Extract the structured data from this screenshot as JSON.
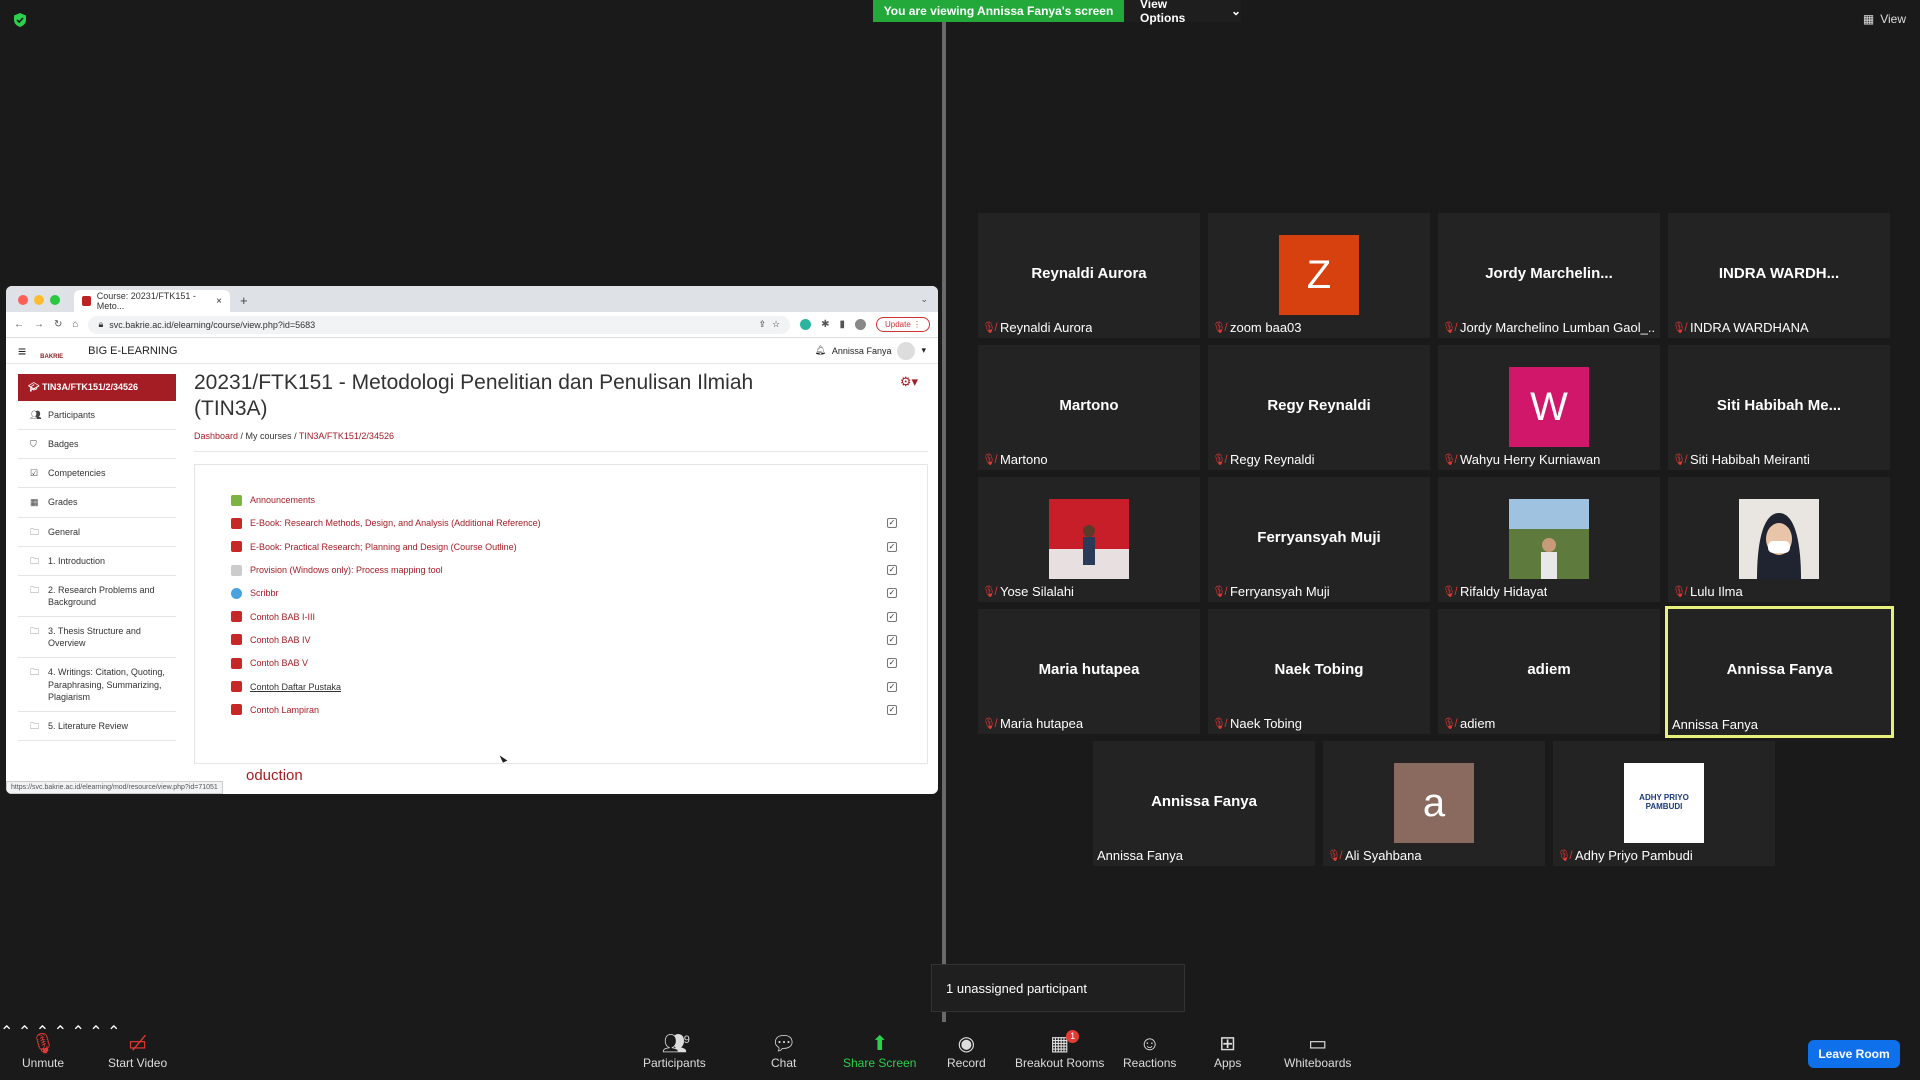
{
  "top": {
    "viewing_banner": "You are viewing Annissa Fanya's screen",
    "view_options": "View Options",
    "view": "View"
  },
  "browser": {
    "tab_title": "Course: 20231/FTK151 - Meto...",
    "url": "svc.bakrie.ac.id/elearning/course/view.php?id=5683",
    "update_label": "Update",
    "status_url": "https://svc.bakrie.ac.id/elearning/mod/resource/view.php?id=71051"
  },
  "site": {
    "brand": "BIG E-LEARNING",
    "logo_text": "BAKRIE",
    "user": "Annissa Fanya",
    "course_title": "20231/FTK151 - Metodologi Penelitian dan Penulisan Ilmiah (TIN3A)",
    "breadcrumb": [
      "Dashboard",
      "My courses",
      "TIN3A/FTK151/2/34526"
    ],
    "section_peek": "oduction"
  },
  "leftnav": {
    "header": "TIN3A/FTK151/2/34526",
    "items": [
      {
        "icon": "users-icon",
        "label": "Participants"
      },
      {
        "icon": "badge-icon",
        "label": "Badges"
      },
      {
        "icon": "checkbox-icon",
        "label": "Competencies"
      },
      {
        "icon": "table-icon",
        "label": "Grades"
      },
      {
        "icon": "folder-icon",
        "label": "General"
      },
      {
        "icon": "folder-icon",
        "label": "1. Introduction"
      },
      {
        "icon": "folder-icon",
        "label": "2. Research Problems and Background"
      },
      {
        "icon": "folder-icon",
        "label": "3. Thesis Structure and Overview"
      },
      {
        "icon": "folder-icon",
        "label": "4. Writings: Citation, Quoting, Paraphrasing, Summarizing, Plagiarism"
      },
      {
        "icon": "folder-icon",
        "label": "5. Literature Review"
      }
    ]
  },
  "resources": [
    {
      "label": "Announcements",
      "icon": "forum-icon"
    },
    {
      "label": "E-Book: Research Methods, Design, and Analysis (Additional Reference)",
      "icon": "pdf-icon"
    },
    {
      "label": "E-Book: Practical Research; Planning and Design (Course Outline)",
      "icon": "pdf-icon"
    },
    {
      "label": "Provision (Windows only): Process mapping tool",
      "icon": "file-icon"
    },
    {
      "label": "Scribbr",
      "icon": "url-icon"
    },
    {
      "label": "Contoh BAB I-III",
      "icon": "pdf-icon"
    },
    {
      "label": "Contoh BAB IV",
      "icon": "pdf-icon"
    },
    {
      "label": "Contoh BAB V",
      "icon": "pdf-icon"
    },
    {
      "label": "Contoh Daftar Pustaka",
      "icon": "pdf-icon"
    },
    {
      "label": "Contoh Lampiran",
      "icon": "pdf-icon"
    }
  ],
  "participants": [
    {
      "center": "Reynaldi Aurora",
      "name": "Reynaldi Aurora",
      "muted": true
    },
    {
      "avatar_letter": "Z",
      "avatar_color": "#d7410f",
      "name": "zoom baa03",
      "muted": true
    },
    {
      "center": "Jordy  Marchelin...",
      "name": "Jordy Marchelino Lumban Gaol_...",
      "muted": true
    },
    {
      "center": "INDRA  WARDH...",
      "name": "INDRA WARDHANA",
      "muted": true
    },
    {
      "center": "Martono",
      "name": "Martono",
      "muted": true
    },
    {
      "center": "Regy Reynaldi",
      "name": "Regy Reynaldi",
      "muted": true
    },
    {
      "avatar_letter": "W",
      "avatar_color": "#d0176a",
      "name": "Wahyu Herry Kurniawan",
      "muted": true
    },
    {
      "center": "Siti  Habibah  Me...",
      "name": "Siti Habibah Meiranti",
      "muted": true
    },
    {
      "photo": "person-red-background",
      "name": "Yose Silalahi",
      "muted": true
    },
    {
      "center": "Ferryansyah Muji",
      "name": "Ferryansyah Muji",
      "muted": true
    },
    {
      "photo": "person-outdoor",
      "name": "Rifaldy Hidayat",
      "muted": true
    },
    {
      "photo": "person-hijab",
      "name": "Lulu Ilma",
      "muted": true
    },
    {
      "center": "Maria hutapea",
      "name": "Maria hutapea",
      "muted": true
    },
    {
      "center": "Naek Tobing",
      "name": "Naek Tobing",
      "muted": true
    },
    {
      "center": "adiem",
      "name": "adiem",
      "muted": true
    },
    {
      "center": "Annissa Fanya",
      "name": "Annissa Fanya",
      "muted": false,
      "active": true
    },
    {
      "center": "Annissa Fanya",
      "name": "Annissa Fanya",
      "muted": false
    },
    {
      "avatar_letter": "a",
      "avatar_color": "#8a6a5e",
      "name": "Ali Syahbana",
      "muted": true
    },
    {
      "logo": "ADHY PRIYO PAMBUDI",
      "name": "Adhy Priyo Pambudi",
      "muted": true
    }
  ],
  "breakout": {
    "unassigned": "1 unassigned participant"
  },
  "toolbar": {
    "unmute": "Unmute",
    "start_video": "Start Video",
    "participants": "Participants",
    "participants_count": "19",
    "chat": "Chat",
    "share_screen": "Share Screen",
    "record": "Record",
    "breakout_rooms": "Breakout Rooms",
    "breakout_badge": "1",
    "reactions": "Reactions",
    "apps": "Apps",
    "whiteboards": "Whiteboards",
    "leave_room": "Leave Room"
  },
  "colors": {
    "banner_green": "#22a93a",
    "active_border": "#e6f07a",
    "moodle_red": "#a51d24",
    "leave_blue": "#0e71eb"
  }
}
